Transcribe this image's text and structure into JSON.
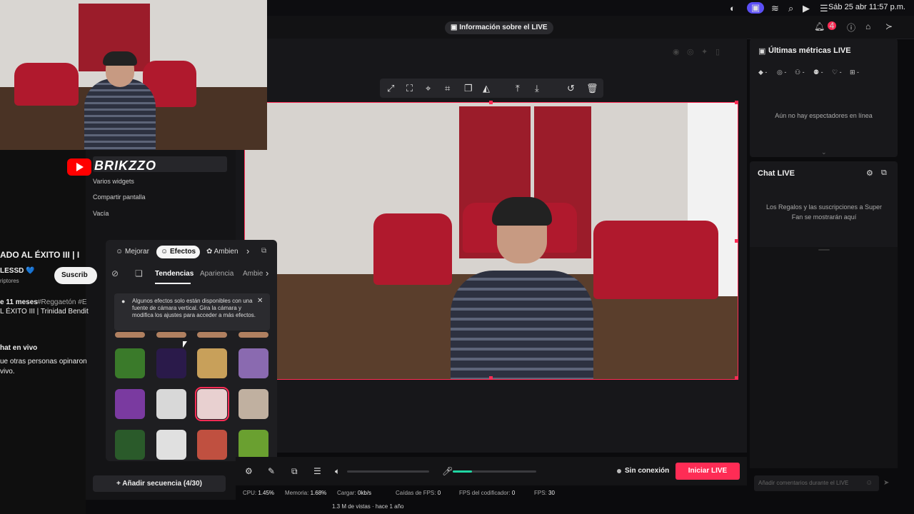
{
  "menubar": {
    "date": "Sáb 25 abr  11:57 p.m."
  },
  "topbar": {
    "live_info": "Información sobre el LIVE",
    "notification_count": "4"
  },
  "youtube": {
    "brand": "BRIKZZO",
    "title_fragment": "ADO AL ÉXITO III | I",
    "channel_fragment": "LESSD 💙",
    "subs_fragment": "riptores",
    "subscribe_label": "Suscrib",
    "age": "e 11 meses",
    "tags": "#Reggaetón #E",
    "desc_fragment": "L ÉXITO III | Trinidad Bendit",
    "chat_title": "hat en vivo",
    "chat_line1": "ue otras personas opinaron",
    "chat_line2": "vivo.",
    "views": "1.3 M de vistas · hace 1 año"
  },
  "sources": {
    "items": [
      "Varios widgets",
      "Compartir pantalla",
      "Vacía"
    ],
    "add_sequence": "Añadir secuencia (4/30)"
  },
  "effects": {
    "tabs": [
      "Mejorar",
      "Efectos",
      "Ambien"
    ],
    "active_tab": "Efectos",
    "subtabs": [
      "Tendencias",
      "Apariencia",
      "Ambie"
    ],
    "active_subtab": "Tendencias",
    "notice": "Algunos efectos solo están disponibles con una fuente de cámara vertical. Gira la cámara y modifica los ajustes para acceder a más efectos.",
    "thumb_colors": [
      "#3a7a2a",
      "#2a1a4a",
      "#c8a05a",
      "#8a6ab0",
      "#7a3aa0",
      "#d8d8d8",
      "#e8d0d0",
      "#c0b0a0",
      "#2a5a2a",
      "#e0e0e0",
      "#c05040",
      "#6aa030"
    ]
  },
  "controls": {
    "status": "Sin conexión",
    "go_live": "Iniciar LIVE",
    "volume_level": 0,
    "mic_level": 0.23
  },
  "stats": {
    "cpu_label": "CPU:",
    "cpu": "1.45%",
    "mem_label": "Memoria:",
    "mem": "1.68%",
    "load_label": "Cargar:",
    "load": "0kb/s",
    "drops_label": "Caídas de FPS:",
    "drops": "0",
    "enc_label": "FPS del codificador:",
    "enc": "0",
    "fps_label": "FPS:",
    "fps": "30"
  },
  "metrics": {
    "title": "Últimas métricas LIVE",
    "empty": "Aún no hay espectadores en línea",
    "icons": [
      "diamond-icon",
      "coin-icon",
      "viewers-icon",
      "follow-icon",
      "heart-icon",
      "gift-icon"
    ]
  },
  "chat": {
    "title": "Chat LIVE",
    "empty": "Los Regalos y las suscripciones a Super Fan se mostrarán aquí",
    "input_placeholder": "Añadir comentarios durante el LIVE"
  }
}
